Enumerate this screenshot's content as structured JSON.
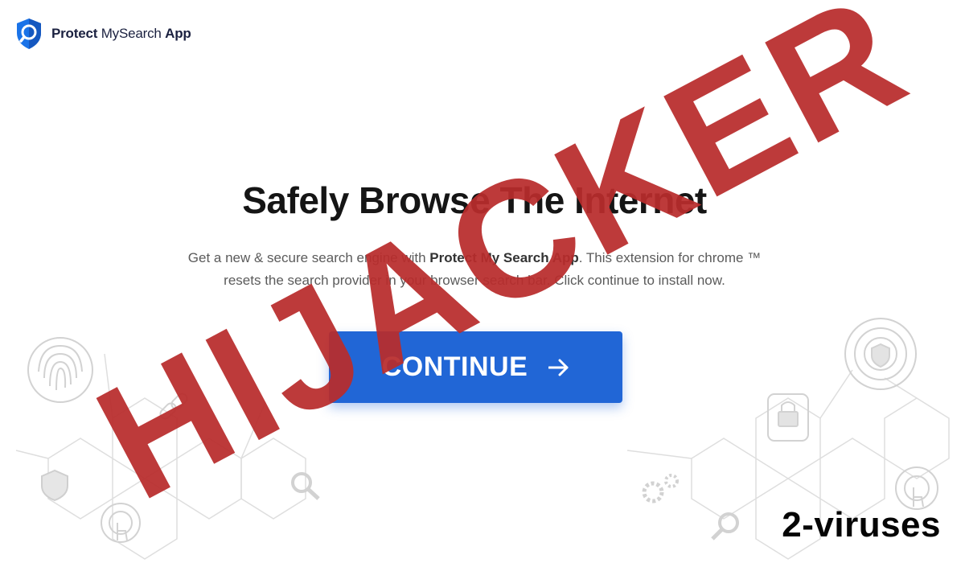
{
  "brand": {
    "name_strong": "Protect",
    "name_light": "MySearch",
    "name_suffix": "App",
    "colors": {
      "shield": "#1a73e8",
      "text": "#1b2140"
    }
  },
  "hero": {
    "title": "Safely Browse The Internet",
    "text_1": "Get a new & secure search engine with ",
    "text_bold": "Protect My Search App",
    "text_2": ". This extension for chrome ™ resets the search provider in your browser search bar. Click continue to install now."
  },
  "cta": {
    "label": "CONTINUE",
    "icon": "arrow-right-icon",
    "color": "#2166d6"
  },
  "overlay": {
    "stamp": "HIJACKER",
    "stamp_color": "#b92c2c",
    "watermark": "2-viruses"
  },
  "decor_icons": [
    "fingerprint-icon",
    "shield-icon",
    "link-icon",
    "touch-icon",
    "search-icon",
    "lock-icon",
    "gears-icon"
  ]
}
